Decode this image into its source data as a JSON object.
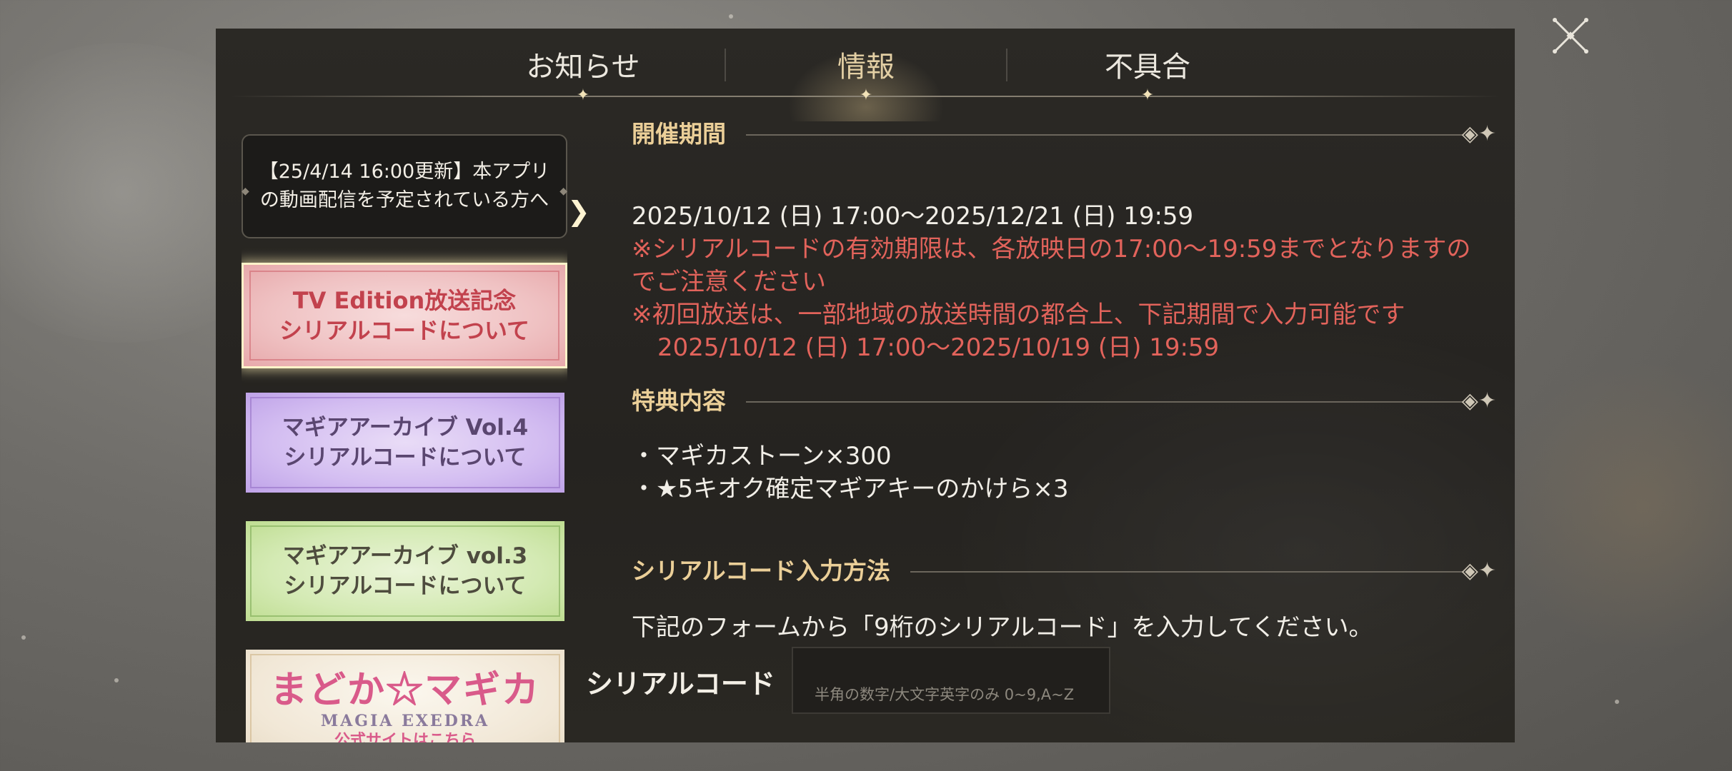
{
  "tabs": [
    {
      "label": "お知らせ"
    },
    {
      "label": "情報"
    },
    {
      "label": "不具合"
    }
  ],
  "active_tab": "情報",
  "sidebar": {
    "items": [
      {
        "line1": "【25/4/14 16:00更新】本アプリ",
        "line2": "の動画配信を予定されている方へ"
      },
      {
        "line1": "TV Edition放送記念",
        "line2": "シリアルコードについて"
      },
      {
        "line1": "マギアアーカイブ Vol.4",
        "line2": "シリアルコードについて"
      },
      {
        "line1": "マギアアーカイブ vol.3",
        "line2": "シリアルコードについて"
      },
      {
        "logo": "まどか☆マギカ",
        "sub": "MAGIA EXEDRA",
        "cta": "公式サイトはこちら"
      }
    ]
  },
  "sections": {
    "period": {
      "title": "開催期間",
      "date_range": "2025/10/12 (日) 17:00～2025/12/21 (日) 19:59",
      "note1_a": "※シリアルコードの有効期限は、各放映日の17:00～19:59までとなりますの",
      "note1_b": "でご注意ください",
      "note2": "※初回放送は、一部地域の放送時間の都合上、下記期間で入力可能です",
      "note2_range": "2025/10/12 (日) 17:00～2025/10/19 (日) 19:59"
    },
    "rewards": {
      "title": "特典内容",
      "items": [
        "・マギカストーン×300",
        "・★5キオク確定マギアキーのかけら×3"
      ]
    },
    "method": {
      "title": "シリアルコード入力方法",
      "text": "下記のフォームから「9桁のシリアルコード」を入力してください。"
    }
  },
  "form": {
    "label": "シリアルコード",
    "placeholder": "半角の数字/大文字英字のみ 0~9,A~Z"
  },
  "colors": {
    "accent_gold": "#ebcf98",
    "note_red": "#e2635b",
    "panel_bg": "#2b2925"
  },
  "icons": {
    "close": "close-icon",
    "tab_star": "sparkle-icon",
    "section_ornament": "ornament-icon",
    "selection_arrow": "chevron-right-icon"
  }
}
